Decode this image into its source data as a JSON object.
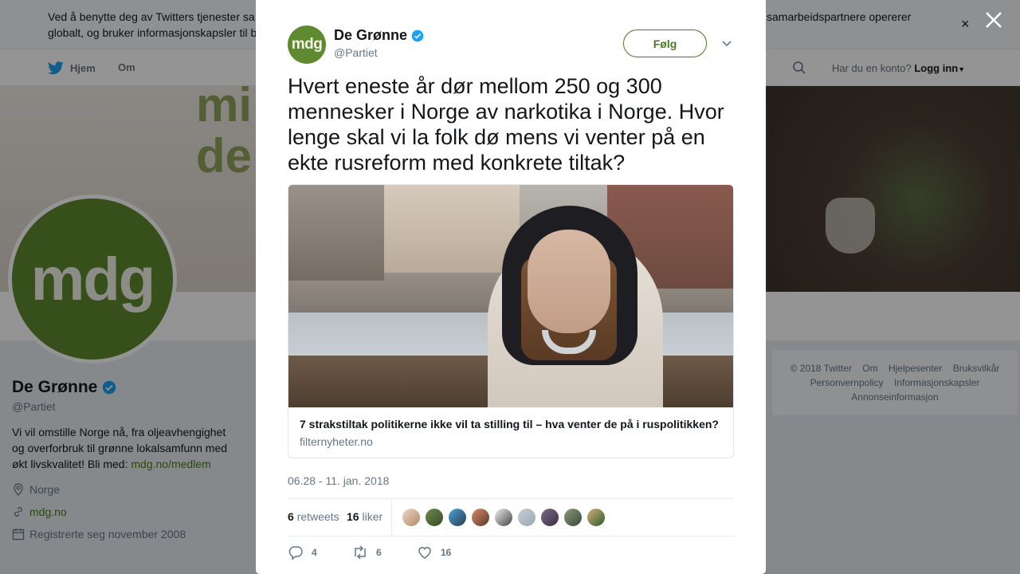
{
  "cookie_bar": {
    "text_left": "Ved å benytte deg av Twitters tjenester sa",
    "text_left_2": "globalt, og bruker informasjonskapsler til b",
    "text_right": "samarbeidspartnere opererer",
    "close_glyph": "×"
  },
  "nav": {
    "home": "Hjem",
    "about": "Om",
    "login_prompt": "Har du en konto?",
    "login": "Logg inn"
  },
  "banner": {
    "text_1": "mi",
    "text_2": "de"
  },
  "profile": {
    "avatar_text": "mdg",
    "name": "De Grønne",
    "handle": "@Partiet",
    "bio": "Vi vil omstille Norge nå, fra oljeavhengighet og overforbruk til grønne lokalsamfunn med økt livskvalitet! Bli med: ",
    "bio_link": "mdg.no/medlem",
    "location": "Norge",
    "url": "mdg.no",
    "joined": "Registrerte seg november 2008"
  },
  "footer": {
    "links": [
      "© 2018 Twitter",
      "Om",
      "Hjelpesenter",
      "Bruksvilkår",
      "Personvernpolicy",
      "Informasjonskapsler",
      "Annonseinformasjon"
    ]
  },
  "tweet": {
    "avatar_text": "mdg",
    "name": "De Grønne",
    "handle": "@Partiet",
    "follow_label": "Følg",
    "text": "Hvert eneste år dør mellom 250 og 300 mennesker i Norge av narkotika i Norge. Hvor lenge skal vi la folk dø mens vi venter på en ekte rusreform med konkrete tiltak?",
    "card_title": "7 strakstiltak politikerne ikke vil ta stilling til – hva venter de på i ruspolitikken?",
    "card_domain": "filternyheter.no",
    "date": "06.28 - 11. jan. 2018",
    "retweets_count": "6",
    "retweets_label": "retweets",
    "likes_count": "16",
    "likes_label": "liker",
    "reply_count": "4",
    "retweet_count": "6",
    "like_count": "16"
  },
  "colors": {
    "brand_green": "#5f8a2f",
    "link_green": "#4a7a1e",
    "verified_blue": "#1da1f2",
    "twitter_blue": "#1da1f2"
  },
  "icons": {
    "close": "close-icon",
    "verified": "verified-icon",
    "caret": "chevron-down-icon",
    "reply": "reply-icon",
    "retweet": "retweet-icon",
    "like": "heart-icon",
    "location": "location-icon",
    "link": "link-icon",
    "calendar": "calendar-icon",
    "search": "search-icon",
    "bird": "twitter-bird-icon"
  }
}
